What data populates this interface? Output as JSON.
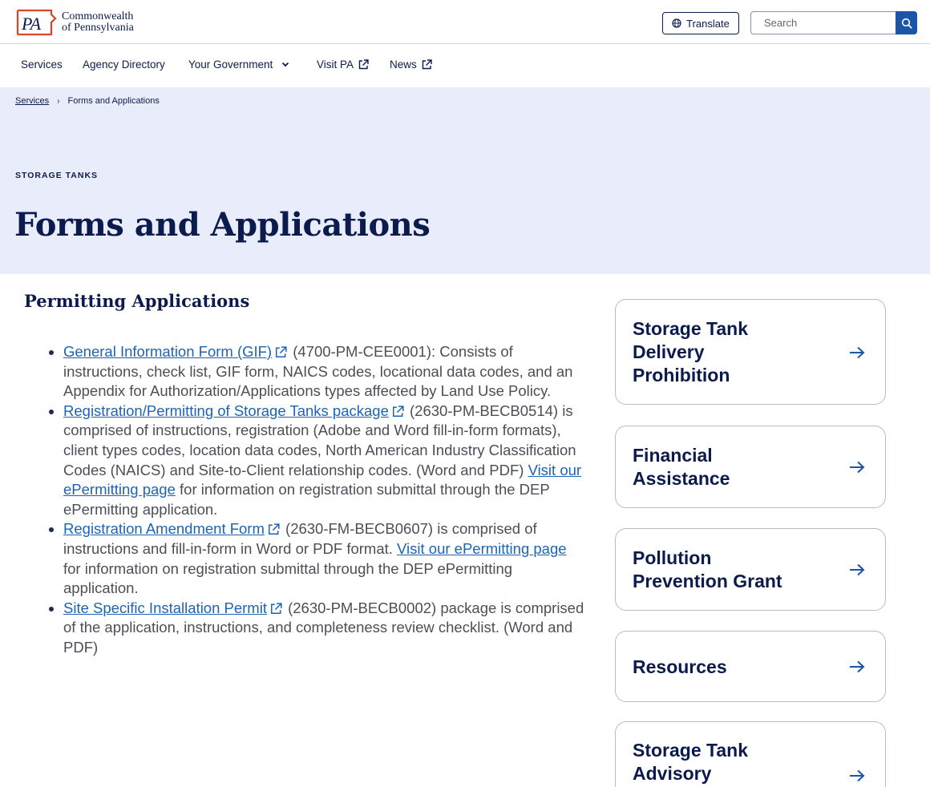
{
  "header": {
    "logo_mark": "PA",
    "logo_line1": "Commonwealth",
    "logo_line2": "of Pennsylvania",
    "translate_label": "Translate",
    "search_placeholder": "Search"
  },
  "nav": {
    "items": [
      {
        "label": "Services"
      },
      {
        "label": "Agency Directory"
      },
      {
        "label": "Your Government"
      },
      {
        "label": "Visit PA"
      },
      {
        "label": "News"
      }
    ]
  },
  "breadcrumb": {
    "root": "Services",
    "separator": "›",
    "current": "Forms and Applications"
  },
  "hero": {
    "eyebrow": "STORAGE TANKS",
    "title": "Forms and Applications"
  },
  "main": {
    "section_title": "Permitting Applications",
    "items": [
      {
        "link": "General Information Form (GIF)",
        "text": " (4700-PM-CEE0001): Consists of instructions, check list, GIF form, NAICS codes, locational data codes, and an Appendix for Authorization/Applications types affected by Land Use Policy."
      },
      {
        "link": "Registration/Permitting of Storage Tanks package",
        "text": " (2630-PM-BECB0514) is comprised of instructions, registration (Adobe and Word fill-in-form formats), client types codes, location data codes, North American Industry Classification Codes (NAICS) and Site-to-Client relationship codes. (Word and PDF) ",
        "link2": "Visit our ePermitting page",
        "text2": " for information on registration submittal through the DEP ePermitting application."
      },
      {
        "link": "Registration Amendment Form",
        "text": " (2630-FM-BECB0607) is comprised of instructions and fill-in-form in Word or PDF format. ",
        "link2": "Visit our ePermitting page",
        "text2": " for information on registration submittal through the DEP ePermitting application."
      },
      {
        "link": "Site Specific Installation Permit",
        "text": " (2630-PM-BECB0002) package is comprised of the application, instructions, and completeness review checklist. (Word and PDF)"
      }
    ]
  },
  "sidebar": {
    "cards": [
      {
        "line1": "Storage Tank",
        "line2": "Delivery",
        "line3": "Prohibition"
      },
      {
        "line1": "Financial",
        "line2": "Assistance"
      },
      {
        "line1": "Pollution",
        "line2": "Prevention Grant"
      },
      {
        "line1": "Resources"
      },
      {
        "line1": "Storage Tank",
        "line2": "Advisory"
      }
    ]
  },
  "colors": {
    "navy": "#0b1b4d",
    "link_blue": "#1e63b4",
    "hero_bg": "#e8ecfb",
    "search_button": "#1a55a8",
    "logo_orange": "#d9442a"
  },
  "icons": [
    "globe-icon",
    "search-icon",
    "chevron-down-icon",
    "external-link-icon",
    "arrow-right-icon"
  ]
}
